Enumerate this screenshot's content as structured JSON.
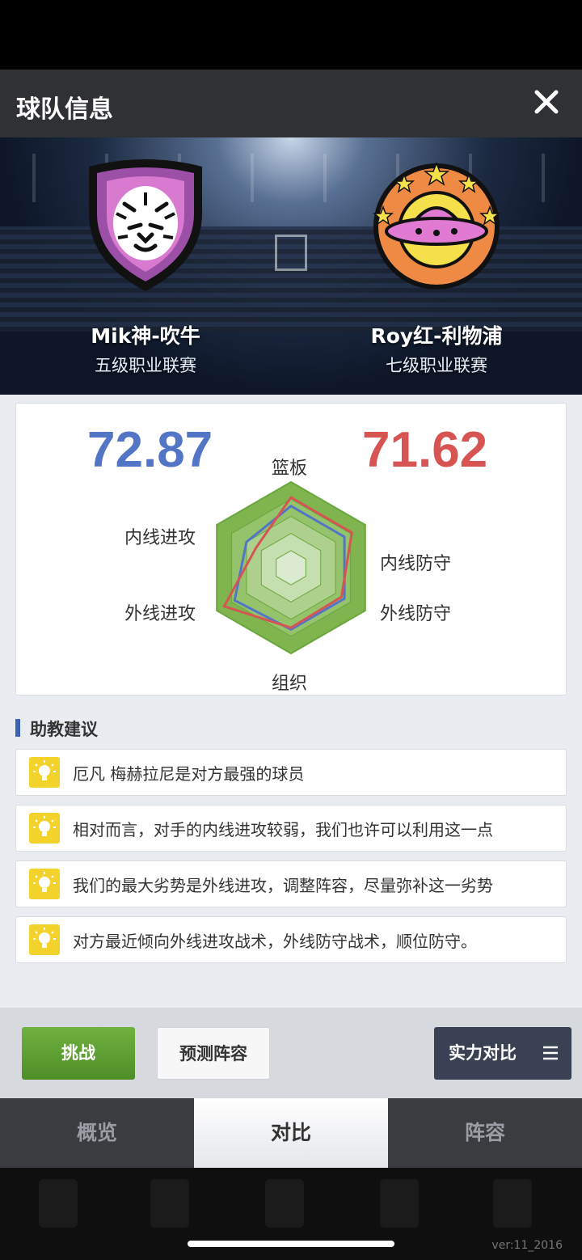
{
  "window": {
    "title": "球队信息"
  },
  "teams": {
    "home": {
      "name": "Mik神-吹牛",
      "league": "五级职业联赛",
      "score": "72.87",
      "color": "#5375c6"
    },
    "away": {
      "name": "Roy红-利物浦",
      "league": "七级职业联赛",
      "score": "71.62",
      "color": "#d65553"
    }
  },
  "radar": {
    "axes": [
      "篮板",
      "内线防守",
      "外线防守",
      "组织",
      "外线进攻",
      "内线进攻"
    ],
    "home_values": [
      0.72,
      0.72,
      0.72,
      0.72,
      0.76,
      0.6
    ],
    "away_values": [
      0.82,
      0.82,
      0.68,
      0.7,
      0.9,
      0.47
    ]
  },
  "advice": {
    "title": "助教建议",
    "tips": [
      "厄凡 梅赫拉尼是对方最强的球员",
      "相对而言，对手的内线进攻较弱，我们也许可以利用这一点",
      "我们的最大劣势是外线进攻，调整阵容，尽量弥补这一劣势",
      "对方最近倾向外线进攻战术，外线防守战术，顺位防守。"
    ]
  },
  "actions": {
    "challenge": "挑战",
    "predict": "预测阵容",
    "compare": "实力对比"
  },
  "tabs": [
    "概览",
    "对比",
    "阵容"
  ],
  "active_tab": "对比",
  "version": "ver:11_2016"
}
